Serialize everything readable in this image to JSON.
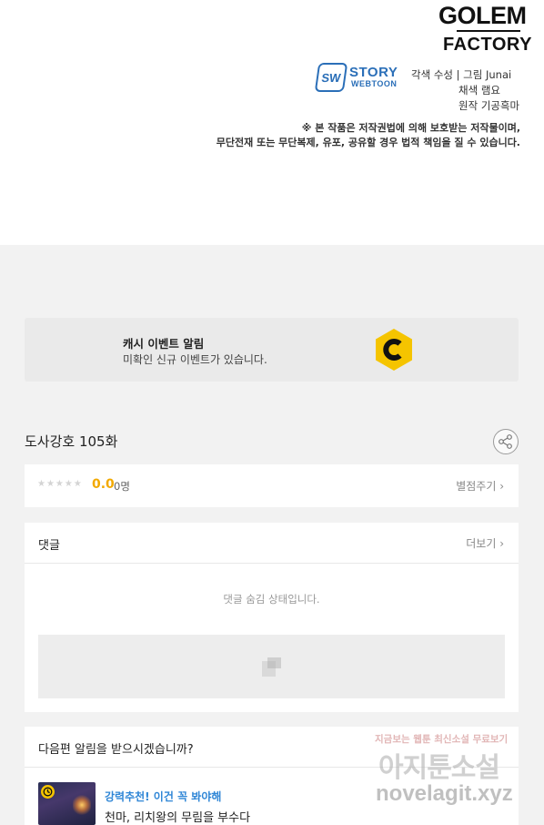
{
  "credits": {
    "publisher_logo_line1": "GOLEM",
    "publisher_logo_line2": "FACTORY",
    "studio_logo_badge": "SW",
    "studio_logo_line1": "STORY",
    "studio_logo_line2": "WEBTOON",
    "line1": "각색 수성 | 그림 Junai",
    "line2": "채색 램요",
    "line3": "원작 기공흑마",
    "copyright_line1": "※ 본 작품은 저작권법에 의해 보호받는 저작물이며,",
    "copyright_line2": "무단전재 또는 무단복제, 유포, 공유할 경우 법적 책임을 질 수 있습니다."
  },
  "cash_banner": {
    "title": "캐시 이벤트 알림",
    "subtitle": "미확인 신규 이벤트가 있습니다.",
    "icon": "cash-c-icon",
    "accent": "#f5c400"
  },
  "episode": {
    "title": "도사강호 105화"
  },
  "rating": {
    "stars": "★★★★★",
    "score": "0.0",
    "count": "0명",
    "rate_link": "별점주기 ›"
  },
  "comments": {
    "label": "댓글",
    "more_link": "더보기 ›",
    "hidden_message": "댓글 숨김 상태입니다."
  },
  "notify": {
    "question": "다음편 알림을 받으시겠습니까?",
    "rec_tag": "강력추천! 이건 꼭 봐야해",
    "rec_title": "천마, 리치왕의 무림을 부수다",
    "tag_color": "#2f86d6"
  },
  "watermark": {
    "small": "지금보는 웹툰 최신소설 무료보기",
    "big": "아지툰소설",
    "url": "novelagit.xyz"
  }
}
